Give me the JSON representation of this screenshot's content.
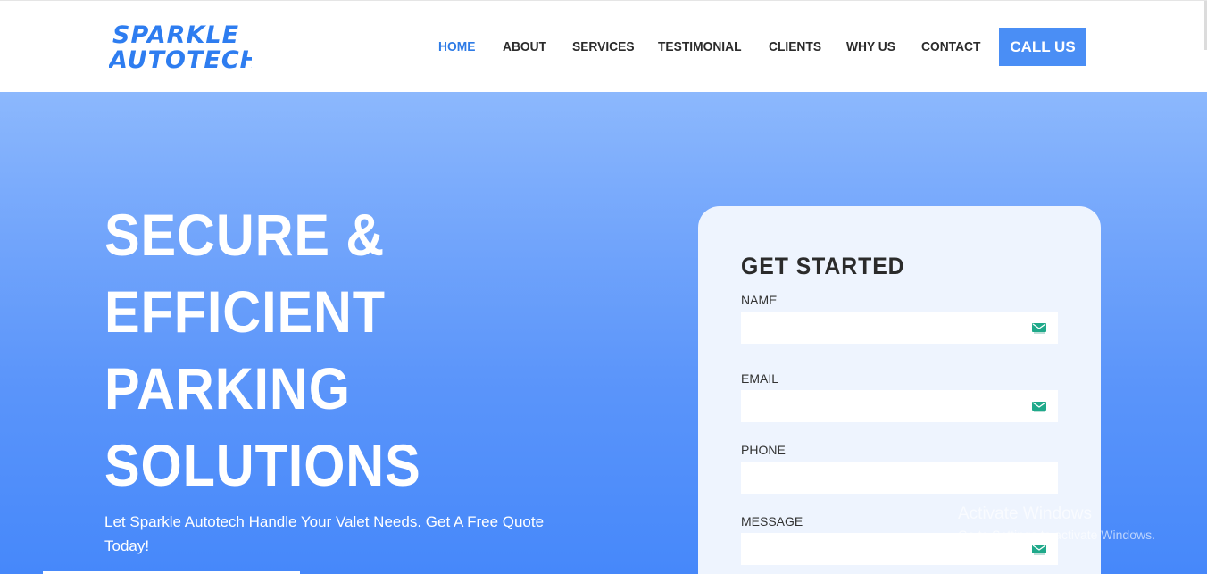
{
  "logo": {
    "line1": "SPARKLE",
    "line2": "AUTOTECH"
  },
  "nav": {
    "items": [
      {
        "label": "HOME",
        "active": true
      },
      {
        "label": "ABOUT",
        "active": false
      },
      {
        "label": "SERVICES",
        "active": false
      },
      {
        "label": "TESTIMONIAL",
        "active": false
      },
      {
        "label": "CLIENTS",
        "active": false
      },
      {
        "label": "WHY US",
        "active": false
      },
      {
        "label": "CONTACT",
        "active": false
      }
    ],
    "cta_label": "CALL US"
  },
  "hero": {
    "title_lines": [
      "SECURE &",
      "EFFICIENT",
      "PARKING",
      "SOLUTIONS"
    ],
    "subtitle": "Let Sparkle Autotech Handle Your Valet Needs. Get A Free Quote Today!"
  },
  "form": {
    "title": "GET STARTED",
    "fields": [
      {
        "label": "NAME",
        "value": "",
        "icon": "mail-icon"
      },
      {
        "label": "EMAIL",
        "value": "",
        "icon": "mail-icon"
      },
      {
        "label": "PHONE",
        "value": "",
        "icon": ""
      },
      {
        "label": "MESSAGE",
        "value": "",
        "icon": "mail-icon"
      }
    ]
  },
  "watermark": {
    "title": "Activate Windows",
    "subtitle": "Go to Settings to activate Windows."
  },
  "colors": {
    "brand": "#2e7df0",
    "nav_active": "#2e7be6",
    "cta_bg": "#4a8ef5",
    "hero_top": "#8cb8fd",
    "hero_bottom": "#4688fa",
    "form_bg": "#eef4fe",
    "icon_teal": "#1fa98a"
  }
}
